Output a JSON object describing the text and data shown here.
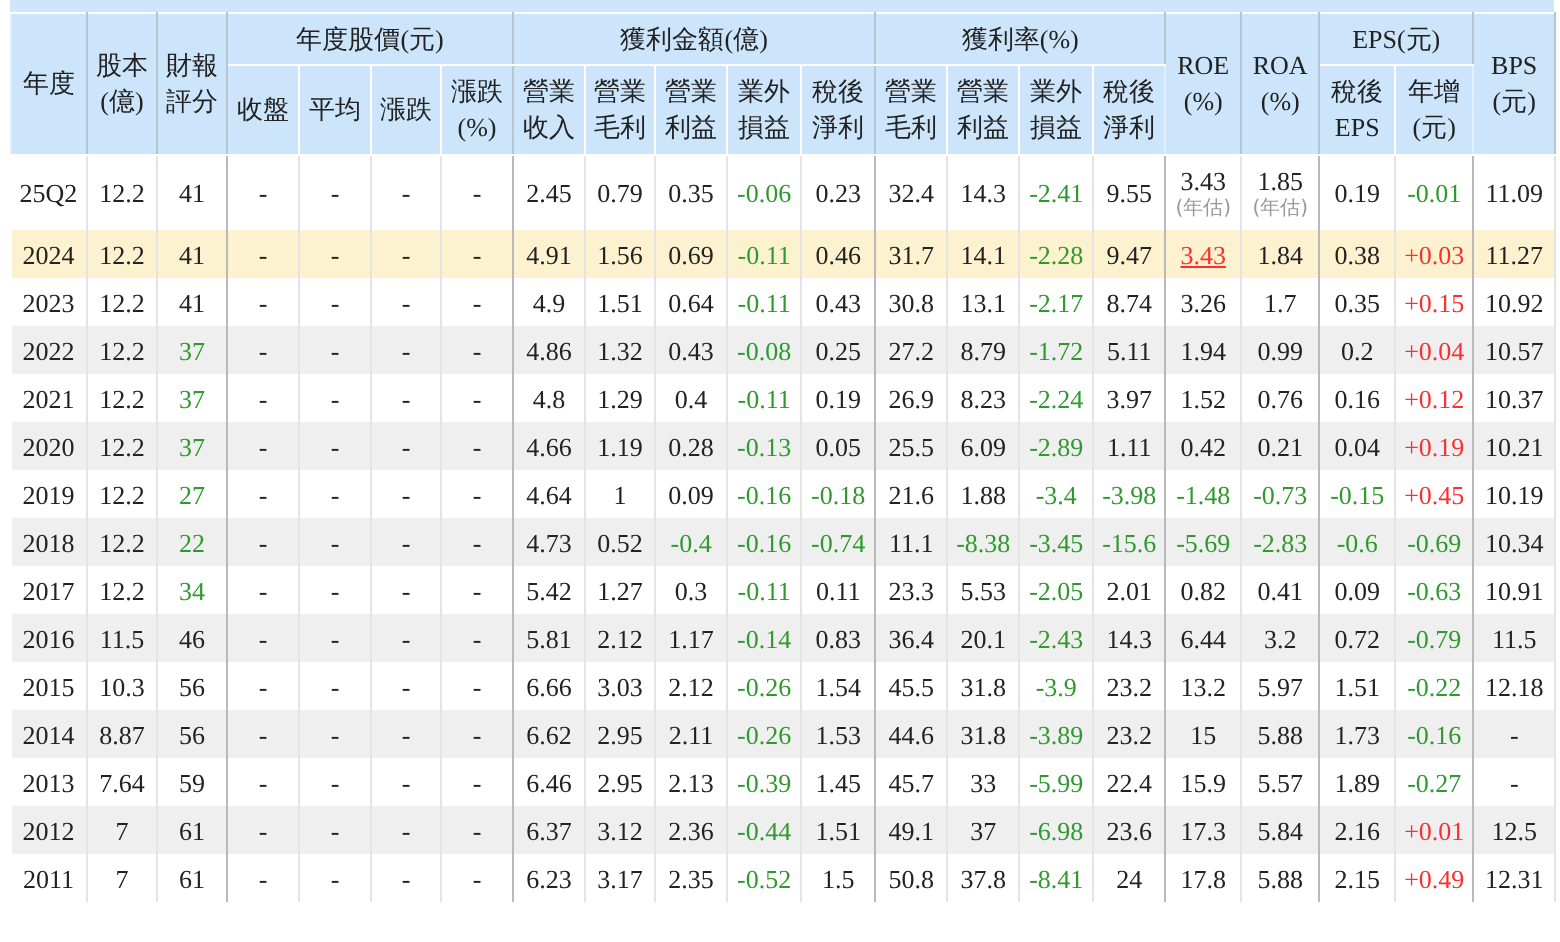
{
  "header": [
    {
      "label": "年度"
    },
    {
      "label": "股本\n(億)"
    },
    {
      "label": "財報評分"
    },
    {
      "label": "年度股價(元)",
      "columns": [
        "收盤",
        "平均",
        "漲跌",
        "漲跌\n(%)"
      ]
    },
    {
      "label": "獲利金額(億)",
      "columns": [
        "營業收入",
        "營業毛利",
        "營業利益",
        "業外損益",
        "稅後淨利"
      ]
    },
    {
      "label": "獲利率(%)",
      "columns": [
        "營業毛利",
        "營業利益",
        "業外損益",
        "稅後淨利"
      ]
    },
    {
      "label": "ROE\n(%)"
    },
    {
      "label": "ROA\n(%)"
    },
    {
      "label": "EPS(元)",
      "columns": [
        "稅後\nEPS",
        "年增\n(元)"
      ]
    },
    {
      "label": "BPS\n(元)"
    }
  ],
  "rows": [
    {
      "highlighted": false,
      "cells": [
        "25Q2",
        "12.2",
        "41",
        "-",
        "-",
        "-",
        "-",
        "2.45",
        "0.79",
        "0.35",
        {
          "text": "-0.06",
          "color": "#2e9a2e"
        },
        "0.23",
        "32.4",
        "14.3",
        {
          "text": "-2.41",
          "color": "#2e9a2e"
        },
        "9.55",
        {
          "text": "3.43",
          "note": "(年估)"
        },
        {
          "text": "1.85",
          "note": "(年估)"
        },
        "0.19",
        {
          "text": "-0.01",
          "color": "#2e9a2e"
        },
        "11.09"
      ]
    },
    {
      "highlighted": true,
      "cells": [
        "2024",
        "12.2",
        "41",
        "-",
        "-",
        "-",
        "-",
        "4.91",
        "1.56",
        "0.69",
        {
          "text": "-0.11",
          "color": "#2e9a2e"
        },
        "0.46",
        "31.7",
        "14.1",
        {
          "text": "-2.28",
          "color": "#2e9a2e"
        },
        "9.47",
        {
          "text": "3.43",
          "kind": "link"
        },
        "1.84",
        "0.38",
        {
          "text": "+0.03",
          "color": "#ff2d2d"
        },
        "11.27"
      ]
    },
    {
      "highlighted": false,
      "cells": [
        "2023",
        "12.2",
        "41",
        "-",
        "-",
        "-",
        "-",
        "4.9",
        "1.51",
        "0.64",
        {
          "text": "-0.11",
          "color": "#2e9a2e"
        },
        "0.43",
        "30.8",
        "13.1",
        {
          "text": "-2.17",
          "color": "#2e9a2e"
        },
        "8.74",
        "3.26",
        "1.7",
        "0.35",
        {
          "text": "+0.15",
          "color": "#ff2d2d"
        },
        "10.92"
      ]
    },
    {
      "highlighted": false,
      "cells": [
        "2022",
        "12.2",
        {
          "text": "37",
          "color": "#2e9a2e"
        },
        "-",
        "-",
        "-",
        "-",
        "4.86",
        "1.32",
        "0.43",
        {
          "text": "-0.08",
          "color": "#2e9a2e"
        },
        "0.25",
        "27.2",
        "8.79",
        {
          "text": "-1.72",
          "color": "#2e9a2e"
        },
        "5.11",
        "1.94",
        "0.99",
        "0.2",
        {
          "text": "+0.04",
          "color": "#ff2d2d"
        },
        "10.57"
      ]
    },
    {
      "highlighted": false,
      "cells": [
        "2021",
        "12.2",
        {
          "text": "37",
          "color": "#2e9a2e"
        },
        "-",
        "-",
        "-",
        "-",
        "4.8",
        "1.29",
        "0.4",
        {
          "text": "-0.11",
          "color": "#2e9a2e"
        },
        "0.19",
        "26.9",
        "8.23",
        {
          "text": "-2.24",
          "color": "#2e9a2e"
        },
        "3.97",
        "1.52",
        "0.76",
        "0.16",
        {
          "text": "+0.12",
          "color": "#ff2d2d"
        },
        "10.37"
      ]
    },
    {
      "highlighted": false,
      "cells": [
        "2020",
        "12.2",
        {
          "text": "37",
          "color": "#2e9a2e"
        },
        "-",
        "-",
        "-",
        "-",
        "4.66",
        "1.19",
        "0.28",
        {
          "text": "-0.13",
          "color": "#2e9a2e"
        },
        "0.05",
        "25.5",
        "6.09",
        {
          "text": "-2.89",
          "color": "#2e9a2e"
        },
        "1.11",
        "0.42",
        "0.21",
        "0.04",
        {
          "text": "+0.19",
          "color": "#ff2d2d"
        },
        "10.21"
      ]
    },
    {
      "highlighted": false,
      "cells": [
        "2019",
        "12.2",
        {
          "text": "27",
          "color": "#2e9a2e"
        },
        "-",
        "-",
        "-",
        "-",
        "4.64",
        "1",
        "0.09",
        {
          "text": "-0.16",
          "color": "#2e9a2e"
        },
        {
          "text": "-0.18",
          "color": "#2e9a2e"
        },
        "21.6",
        "1.88",
        {
          "text": "-3.4",
          "color": "#2e9a2e"
        },
        {
          "text": "-3.98",
          "color": "#2e9a2e"
        },
        {
          "text": "-1.48",
          "color": "#2e9a2e"
        },
        {
          "text": "-0.73",
          "color": "#2e9a2e"
        },
        {
          "text": "-0.15",
          "color": "#2e9a2e"
        },
        {
          "text": "+0.45",
          "color": "#ff2d2d"
        },
        "10.19"
      ]
    },
    {
      "highlighted": false,
      "cells": [
        "2018",
        "12.2",
        {
          "text": "22",
          "color": "#2e9a2e"
        },
        "-",
        "-",
        "-",
        "-",
        "4.73",
        "0.52",
        {
          "text": "-0.4",
          "color": "#2e9a2e"
        },
        {
          "text": "-0.16",
          "color": "#2e9a2e"
        },
        {
          "text": "-0.74",
          "color": "#2e9a2e"
        },
        "11.1",
        {
          "text": "-8.38",
          "color": "#2e9a2e"
        },
        {
          "text": "-3.45",
          "color": "#2e9a2e"
        },
        {
          "text": "-15.6",
          "color": "#2e9a2e"
        },
        {
          "text": "-5.69",
          "color": "#2e9a2e"
        },
        {
          "text": "-2.83",
          "color": "#2e9a2e"
        },
        {
          "text": "-0.6",
          "color": "#2e9a2e"
        },
        {
          "text": "-0.69",
          "color": "#2e9a2e"
        },
        "10.34"
      ]
    },
    {
      "highlighted": false,
      "cells": [
        "2017",
        "12.2",
        {
          "text": "34",
          "color": "#2e9a2e"
        },
        "-",
        "-",
        "-",
        "-",
        "5.42",
        "1.27",
        "0.3",
        {
          "text": "-0.11",
          "color": "#2e9a2e"
        },
        "0.11",
        "23.3",
        "5.53",
        {
          "text": "-2.05",
          "color": "#2e9a2e"
        },
        "2.01",
        "0.82",
        "0.41",
        "0.09",
        {
          "text": "-0.63",
          "color": "#2e9a2e"
        },
        "10.91"
      ]
    },
    {
      "highlighted": false,
      "cells": [
        "2016",
        "11.5",
        "46",
        "-",
        "-",
        "-",
        "-",
        "5.81",
        "2.12",
        "1.17",
        {
          "text": "-0.14",
          "color": "#2e9a2e"
        },
        "0.83",
        "36.4",
        "20.1",
        {
          "text": "-2.43",
          "color": "#2e9a2e"
        },
        "14.3",
        "6.44",
        "3.2",
        "0.72",
        {
          "text": "-0.79",
          "color": "#2e9a2e"
        },
        "11.5"
      ]
    },
    {
      "highlighted": false,
      "cells": [
        "2015",
        "10.3",
        "56",
        "-",
        "-",
        "-",
        "-",
        "6.66",
        "3.03",
        "2.12",
        {
          "text": "-0.26",
          "color": "#2e9a2e"
        },
        "1.54",
        "45.5",
        "31.8",
        {
          "text": "-3.9",
          "color": "#2e9a2e"
        },
        "23.2",
        "13.2",
        "5.97",
        "1.51",
        {
          "text": "-0.22",
          "color": "#2e9a2e"
        },
        "12.18"
      ]
    },
    {
      "highlighted": false,
      "cells": [
        "2014",
        "8.87",
        "56",
        "-",
        "-",
        "-",
        "-",
        "6.62",
        "2.95",
        "2.11",
        {
          "text": "-0.26",
          "color": "#2e9a2e"
        },
        "1.53",
        "44.6",
        "31.8",
        {
          "text": "-3.89",
          "color": "#2e9a2e"
        },
        "23.2",
        "15",
        "5.88",
        "1.73",
        {
          "text": "-0.16",
          "color": "#2e9a2e"
        },
        "-"
      ]
    },
    {
      "highlighted": false,
      "cells": [
        "2013",
        "7.64",
        "59",
        "-",
        "-",
        "-",
        "-",
        "6.46",
        "2.95",
        "2.13",
        {
          "text": "-0.39",
          "color": "#2e9a2e"
        },
        "1.45",
        "45.7",
        "33",
        {
          "text": "-5.99",
          "color": "#2e9a2e"
        },
        "22.4",
        "15.9",
        "5.57",
        "1.89",
        {
          "text": "-0.27",
          "color": "#2e9a2e"
        },
        "-"
      ]
    },
    {
      "highlighted": false,
      "cells": [
        "2012",
        "7",
        "61",
        "-",
        "-",
        "-",
        "-",
        "6.37",
        "3.12",
        "2.36",
        {
          "text": "-0.44",
          "color": "#2e9a2e"
        },
        "1.51",
        "49.1",
        "37",
        {
          "text": "-6.98",
          "color": "#2e9a2e"
        },
        "23.6",
        "17.3",
        "5.84",
        "2.16",
        {
          "text": "+0.01",
          "color": "#ff2d2d"
        },
        "12.5"
      ]
    },
    {
      "highlighted": false,
      "cells": [
        "2011",
        "7",
        "61",
        "-",
        "-",
        "-",
        "-",
        "6.23",
        "3.17",
        "2.35",
        {
          "text": "-0.52",
          "color": "#2e9a2e"
        },
        "1.5",
        "50.8",
        "37.8",
        {
          "text": "-8.41",
          "color": "#2e9a2e"
        },
        "24",
        "17.8",
        "5.88",
        "2.15",
        {
          "text": "+0.49",
          "color": "#ff2d2d"
        },
        "12.31"
      ]
    }
  ]
}
